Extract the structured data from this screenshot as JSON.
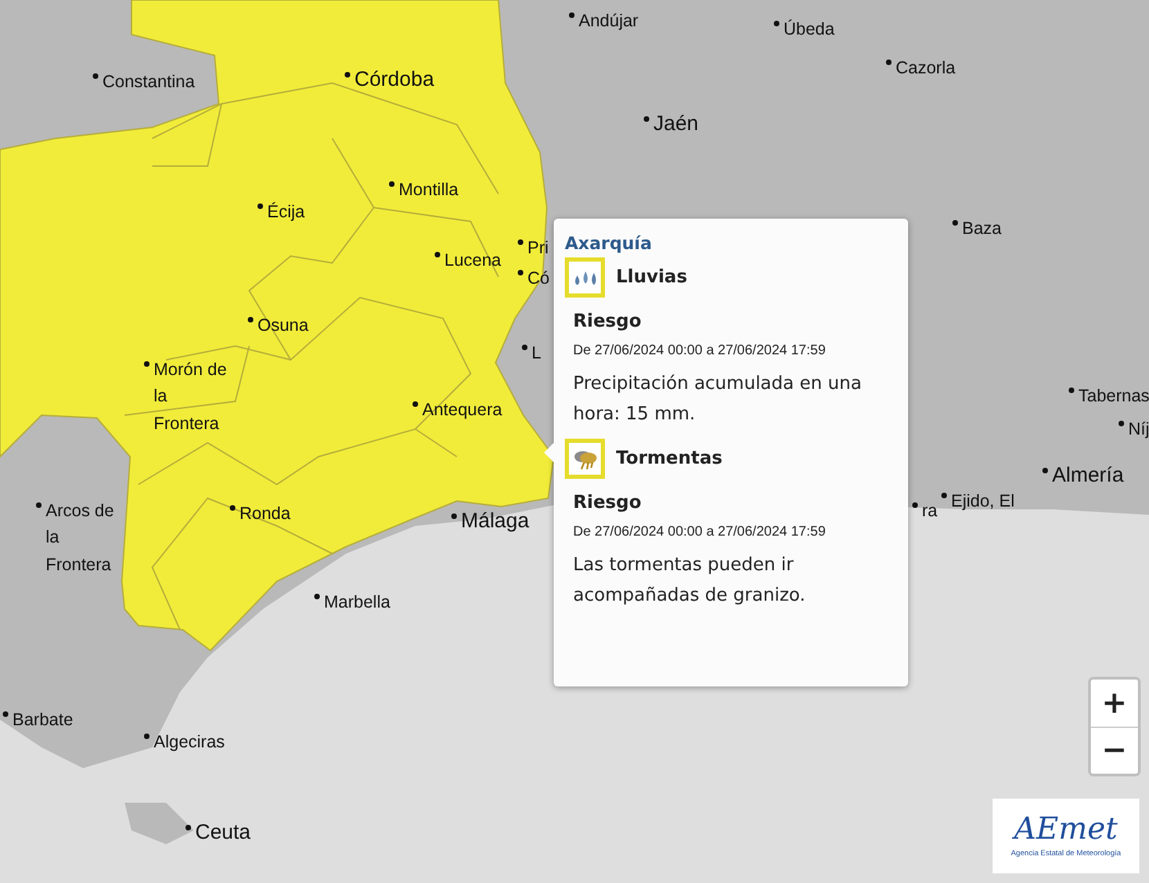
{
  "map": {
    "places": [
      {
        "lines": [
          "Andújar"
        ],
        "kind": "town"
      },
      {
        "lines": [
          "Úbeda"
        ],
        "kind": "town"
      },
      {
        "lines": [
          "Constantina"
        ],
        "kind": "town"
      },
      {
        "lines": [
          "Córdoba"
        ],
        "kind": "capital"
      },
      {
        "lines": [
          "Cazorla"
        ],
        "kind": "town"
      },
      {
        "lines": [
          "Jaén"
        ],
        "kind": "capital"
      },
      {
        "lines": [
          "Écija"
        ],
        "kind": "town"
      },
      {
        "lines": [
          "Montilla"
        ],
        "kind": "town"
      },
      {
        "lines": [
          "Baza"
        ],
        "kind": "town"
      },
      {
        "lines": [
          "Lucena"
        ],
        "kind": "town"
      },
      {
        "lines": [
          "Pri"
        ],
        "kind": "town"
      },
      {
        "lines": [
          "Có"
        ],
        "kind": "town"
      },
      {
        "lines": [
          "Osuna"
        ],
        "kind": "town"
      },
      {
        "lines": [
          "L"
        ],
        "kind": "town"
      },
      {
        "lines": [
          "Morón de",
          "la",
          "Frontera"
        ],
        "kind": "town"
      },
      {
        "lines": [
          "Antequera"
        ],
        "kind": "town"
      },
      {
        "lines": [
          "Tabernas"
        ],
        "kind": "town"
      },
      {
        "lines": [
          "Níj"
        ],
        "kind": "town"
      },
      {
        "lines": [
          "Almería"
        ],
        "kind": "capital"
      },
      {
        "lines": [
          "Arcos de",
          "la",
          "Frontera"
        ],
        "kind": "town"
      },
      {
        "lines": [
          "Ronda"
        ],
        "kind": "town"
      },
      {
        "lines": [
          "Málaga"
        ],
        "kind": "capital"
      },
      {
        "lines": [
          "ra"
        ],
        "kind": "town"
      },
      {
        "lines": [
          "Ejido, El"
        ],
        "kind": "town"
      },
      {
        "lines": [
          "Marbella"
        ],
        "kind": "town"
      },
      {
        "lines": [
          "Barbate"
        ],
        "kind": "town"
      },
      {
        "lines": [
          "Algeciras"
        ],
        "kind": "town"
      },
      {
        "lines": [
          "Ceuta"
        ],
        "kind": "capital"
      }
    ]
  },
  "popup": {
    "title": "Axarquía",
    "warnings": [
      {
        "kind": "rain",
        "title": "Lluvias",
        "level_label": "Riesgo",
        "period": "De 27/06/2024 00:00 a 27/06/2024 17:59",
        "description": "Precipitación acumulada en una hora: 15 mm.",
        "color": "#e6dc2c"
      },
      {
        "kind": "storm",
        "title": "Tormentas",
        "level_label": "Riesgo",
        "period": "De 27/06/2024 00:00 a 27/06/2024 17:59",
        "description": "Las tormentas pueden ir acompañadas de granizo.",
        "color": "#e6dc2c"
      }
    ]
  },
  "zoom": {
    "buttons": [
      "+",
      "−"
    ]
  },
  "logo": {
    "name": "AEmet",
    "subtitle": "Agencia Estatal de Meteorología"
  }
}
